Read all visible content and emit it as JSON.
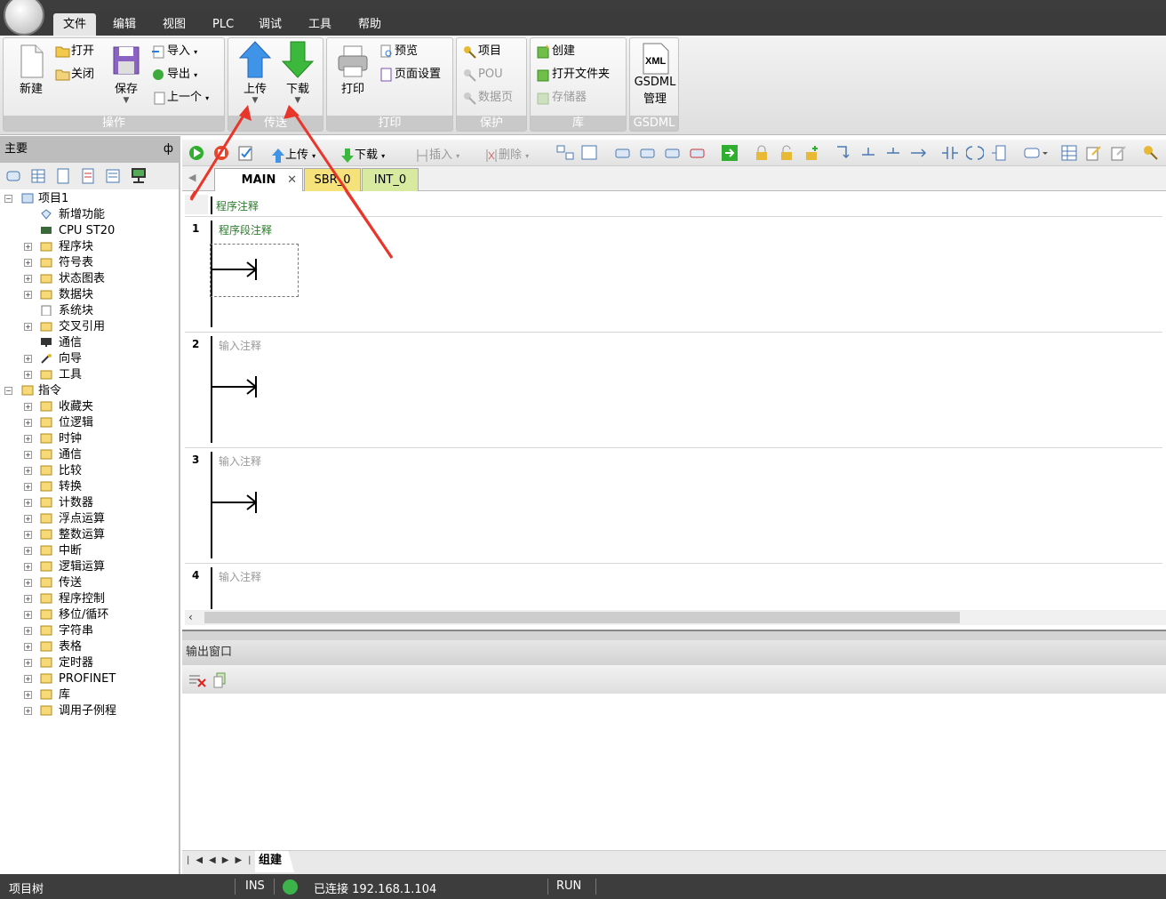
{
  "menubar": {
    "items": [
      "文件",
      "编辑",
      "视图",
      "PLC",
      "调试",
      "工具",
      "帮助"
    ],
    "active": "文件"
  },
  "ribbon": {
    "groups": {
      "operate": {
        "caption": "操作",
        "new": "新建",
        "open": "打开",
        "close": "关闭",
        "save": "保存",
        "import": "导入",
        "export": "导出",
        "prev": "上一个"
      },
      "transfer": {
        "caption": "传送",
        "upload": "上传",
        "download": "下载"
      },
      "print": {
        "caption": "打印",
        "print": "打印",
        "preview": "预览",
        "page_setup": "页面设置"
      },
      "protect": {
        "caption": "保护",
        "project": "项目",
        "pou": "POU",
        "datapage": "数据页"
      },
      "library": {
        "caption": "库",
        "create": "创建",
        "open_folder": "打开文件夹",
        "memory": "存储器"
      },
      "gsdml": {
        "caption": "GSDML",
        "label1": "GSDML",
        "label2": "管理",
        "icon_text": "XML"
      }
    }
  },
  "sidebar": {
    "title": "主要",
    "pin": "ф",
    "project_root": "项目1",
    "project_items": [
      "新增功能",
      "CPU ST20",
      "程序块",
      "符号表",
      "状态图表",
      "数据块",
      "系统块",
      "交叉引用",
      "通信",
      "向导",
      "工具"
    ],
    "instructions_root": "指令",
    "instruction_items": [
      "收藏夹",
      "位逻辑",
      "时钟",
      "通信",
      "比较",
      "转换",
      "计数器",
      "浮点运算",
      "整数运算",
      "中断",
      "逻辑运算",
      "传送",
      "程序控制",
      "移位/循环",
      "字符串",
      "表格",
      "定时器",
      "PROFINET",
      "库",
      "调用子例程"
    ]
  },
  "editor_toolbar": {
    "upload": "上传",
    "download": "下载",
    "insert": "插入",
    "delete": "删除"
  },
  "editor_tabs": [
    {
      "label": "MAIN",
      "color": "#ffffff"
    },
    {
      "label": "SBR_0",
      "color": "#f6e27a"
    },
    {
      "label": "INT_0",
      "color": "#d8eaa0"
    }
  ],
  "editor": {
    "program_comment": "程序注释",
    "networks": [
      {
        "num": "1",
        "comment": "程序段注释"
      },
      {
        "num": "2",
        "comment": "输入注释"
      },
      {
        "num": "3",
        "comment": "输入注释"
      },
      {
        "num": "4",
        "comment": "输入注释"
      }
    ]
  },
  "output": {
    "title": "输出窗口",
    "tab": "组建"
  },
  "status": {
    "tree": "项目树",
    "mode": "INS",
    "connection": "已连接 192.168.1.104",
    "run": "RUN",
    "connected_color": "#3cb44b"
  }
}
